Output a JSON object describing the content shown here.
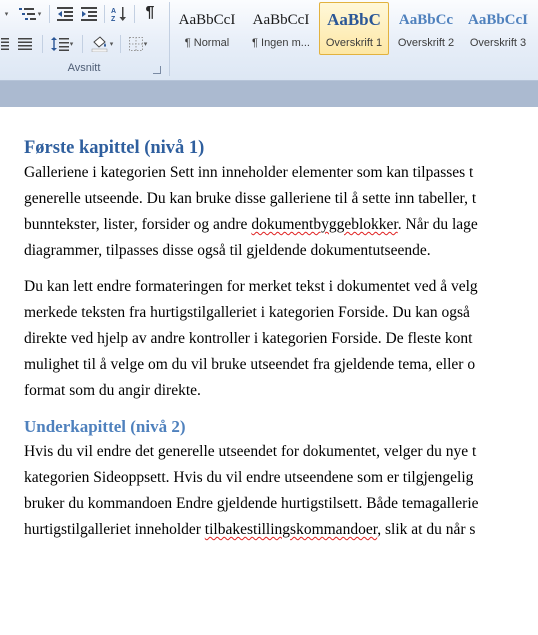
{
  "ribbon": {
    "paragraph_group_label": "Avsnitt",
    "styles": [
      {
        "sample": "AaBbCcI",
        "name": "¶ Normal",
        "kind": "normal",
        "active": false
      },
      {
        "sample": "AaBbCcI",
        "name": "¶ Ingen m...",
        "kind": "normal",
        "active": false
      },
      {
        "sample": "AaBbC",
        "name": "Overskrift 1",
        "kind": "h1",
        "active": true
      },
      {
        "sample": "AaBbCc",
        "name": "Overskrift 2",
        "kind": "h2",
        "active": false
      },
      {
        "sample": "AaBbCcI",
        "name": "Overskrift 3",
        "kind": "h3",
        "active": false
      }
    ]
  },
  "document": {
    "heading1": "Første kapittel (nivå 1)",
    "para1": [
      "Galleriene i kategorien Sett inn inneholder elementer som kan tilpasses t",
      "generelle utseende. Du kan bruke disse galleriene til å sette inn tabeller, t",
      [
        "bunntekster, lister, forsider og andre ",
        "dokumentbyggeblokker",
        ". Når du lage"
      ],
      "diagrammer, tilpasses disse også til gjeldende dokumentutseende."
    ],
    "para2": [
      "Du kan lett endre formateringen for merket tekst i dokumentet ved å velg",
      "merkede teksten fra hurtigstilgalleriet i kategorien Forside. Du kan også",
      "direkte ved hjelp av andre kontroller i kategorien Forside. De fleste kont",
      "mulighet til å velge om du vil bruke utseendet fra gjeldende tema, eller o",
      "format som du angir direkte."
    ],
    "heading2": "Underkapittel (nivå 2)",
    "para3": [
      "Hvis du vil endre det generelle utseendet for dokumentet, velger du nye t",
      "kategorien Sideoppsett. Hvis du vil endre utseendene som er tilgjengelig",
      "bruker du kommandoen Endre gjeldende hurtigstilsett. Både temagallerie",
      [
        "hurtigstilgalleriet inneholder ",
        "tilbakestillingskommandoer",
        ", slik at du når s"
      ]
    ]
  }
}
